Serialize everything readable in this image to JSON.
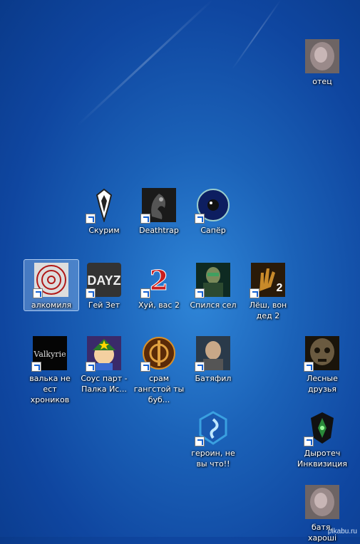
{
  "desktop": {
    "icons": [
      {
        "label": "отец",
        "icon": "photo-icon",
        "color": "#9a8a8a"
      },
      {
        "label": "Скурим",
        "icon": "skyrim-icon",
        "color": "#ffffff"
      },
      {
        "label": "Deathtrap",
        "icon": "deathtrap-icon",
        "color": "#2a2a2a"
      },
      {
        "label": "Сапёр",
        "icon": "minesweeper-icon",
        "color": "#1a3a9a"
      },
      {
        "label": "алкомиля",
        "icon": "silent-hill-icon",
        "color": "#b01818",
        "selected": true
      },
      {
        "label": "Гей Зет",
        "icon": "dayz-icon",
        "color": "#2a2a2a"
      },
      {
        "label": "Хуй, вас 2",
        "icon": "guild-wars-2-icon",
        "color": "#c81e1e"
      },
      {
        "label": "Спился сел",
        "icon": "soldier-icon",
        "color": "#1e4a3a"
      },
      {
        "label": "Лёш, вон дед 2",
        "icon": "left-4-dead-2-icon",
        "color": "#5a3a10"
      },
      {
        "label": "валька не ест хроников",
        "icon": "valkyrie-icon",
        "color": "#111111"
      },
      {
        "label": "Соус парт - Палка Ис...",
        "icon": "south-park-icon",
        "color": "#3a6ad0"
      },
      {
        "label": "срам гангстой ты буб...",
        "icon": "star-wars-old-republic-icon",
        "color": "#7a3a10"
      },
      {
        "label": "Батяфил",
        "icon": "battlefield-icon",
        "color": "#6a6a6a"
      },
      {
        "label": "Лесные друзья",
        "icon": "the-forest-icon",
        "color": "#4a3a20"
      },
      {
        "label": "героин, не вы что!!",
        "icon": "heroes-storm-icon",
        "color": "#3aa0e0"
      },
      {
        "label": "Дыротеч Инквизиция",
        "icon": "dragon-age-icon",
        "color": "#2a8a3a"
      },
      {
        "label": "батя, хароші",
        "icon": "photo-icon",
        "color": "#9a8a8a"
      }
    ]
  },
  "watermark": "pikabu.ru"
}
